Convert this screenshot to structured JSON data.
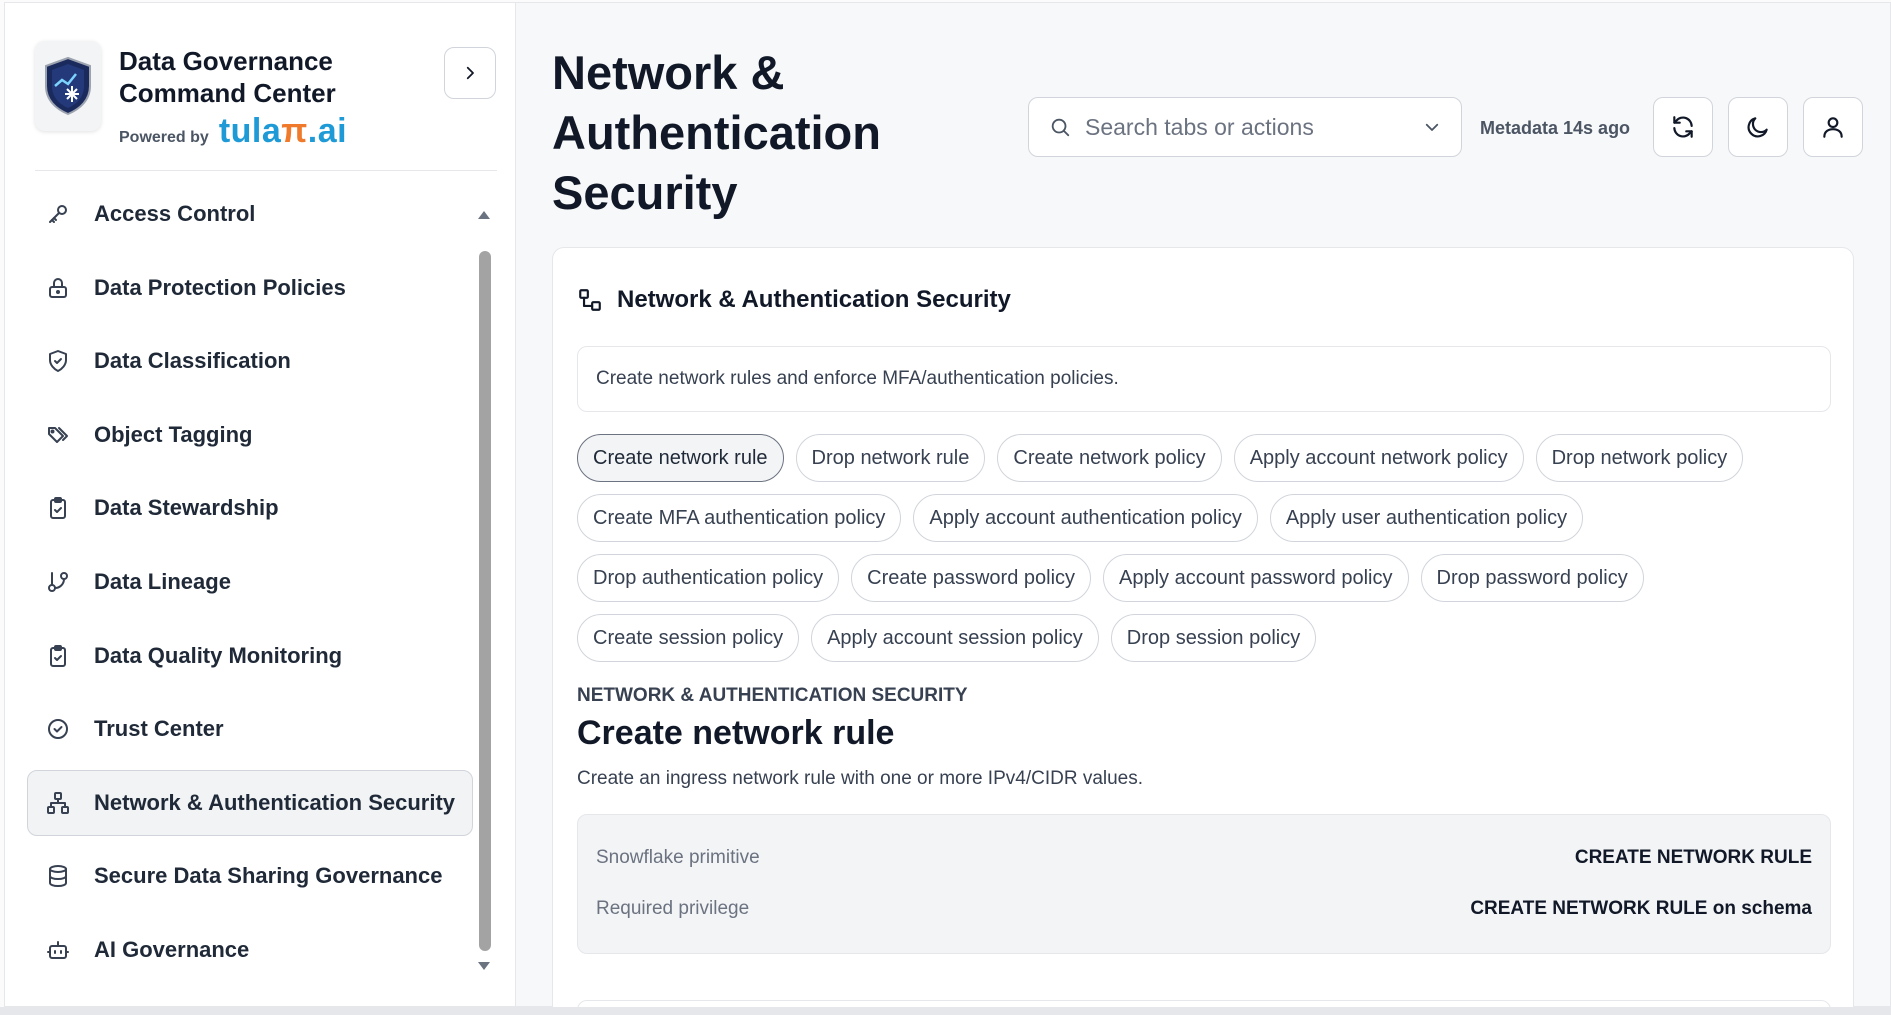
{
  "brand": {
    "title": "Data Governance Command Center",
    "powered_by": "Powered by",
    "logo_text_a": "tula",
    "logo_text_b": "π",
    "logo_text_c": ".ai"
  },
  "sidebar": {
    "items": [
      {
        "label": "Access Control",
        "icon": "key-icon"
      },
      {
        "label": "Data Protection Policies",
        "icon": "lock-icon"
      },
      {
        "label": "Data Classification",
        "icon": "shield-check-icon"
      },
      {
        "label": "Object Tagging",
        "icon": "tags-icon"
      },
      {
        "label": "Data Stewardship",
        "icon": "clipboard-check-icon"
      },
      {
        "label": "Data Lineage",
        "icon": "git-branch-icon"
      },
      {
        "label": "Data Quality Monitoring",
        "icon": "clipboard-check-icon"
      },
      {
        "label": "Trust Center",
        "icon": "check-circle-icon"
      },
      {
        "label": "Network & Authentication Security",
        "icon": "network-icon",
        "active": true
      },
      {
        "label": "Secure Data Sharing Governance",
        "icon": "database-icon"
      },
      {
        "label": "AI Governance",
        "icon": "bot-icon"
      }
    ]
  },
  "header": {
    "title": "Network & Authentication Security",
    "search_placeholder": "Search tabs or actions",
    "metadata_status": "Metadata 14s ago"
  },
  "panel": {
    "title": "Network & Authentication Security",
    "description": "Create network rules and enforce MFA/authentication policies.",
    "action_rows": [
      [
        "Create network rule",
        "Drop network rule",
        "Create network policy",
        "Apply account network policy",
        "Drop network policy"
      ],
      [
        "Create MFA authentication policy",
        "Apply account authentication policy",
        "Apply user authentication policy"
      ],
      [
        "Drop authentication policy",
        "Create password policy",
        "Apply account password policy",
        "Drop password policy"
      ],
      [
        "Create session policy",
        "Apply account session policy",
        "Drop session policy"
      ]
    ],
    "selected_action": "Create network rule"
  },
  "detail": {
    "eyebrow": "NETWORK & AUTHENTICATION SECURITY",
    "title": "Create network rule",
    "description": "Create an ingress network rule with one or more IPv4/CIDR values.",
    "rows": [
      {
        "key": "Snowflake primitive",
        "value": "CREATE NETWORK RULE"
      },
      {
        "key": "Required privilege",
        "value": "CREATE NETWORK RULE on schema"
      }
    ]
  },
  "colors": {
    "accent_blue": "#1e9ad6",
    "accent_orange": "#f07a2b",
    "logo_navy": "#1b2a5c"
  }
}
